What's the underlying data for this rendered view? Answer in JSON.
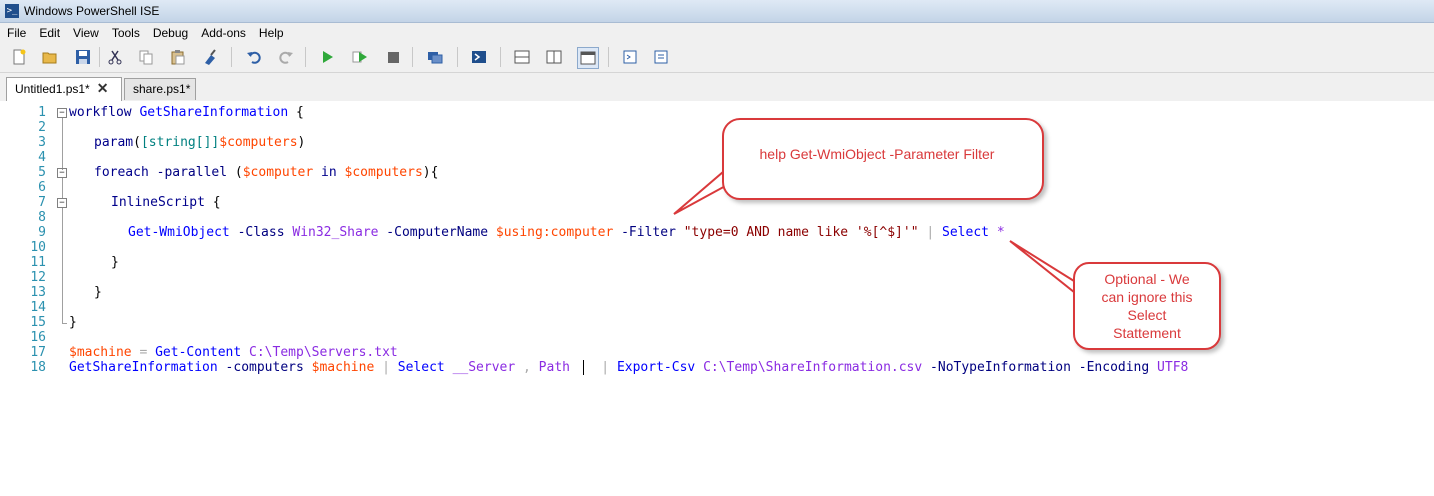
{
  "window": {
    "title": "Windows PowerShell ISE"
  },
  "menu": [
    "File",
    "Edit",
    "View",
    "Tools",
    "Debug",
    "Add-ons",
    "Help"
  ],
  "toolbar": {
    "icons": [
      "new-file",
      "open-folder",
      "save",
      "cut",
      "copy",
      "paste",
      "clear-console",
      "undo",
      "redo",
      "run",
      "run-selection",
      "stop",
      "new-remote-tab",
      "start-powershell",
      "show-script-pane-top",
      "show-script-pane-right",
      "show-script-pane-maximized",
      "show-command-window",
      "show-command-addon"
    ]
  },
  "tabs": [
    {
      "label": "Untitled1.ps1*",
      "active": true,
      "close": "✕"
    },
    {
      "label": "share.ps1*",
      "active": false
    }
  ],
  "editor": {
    "line_numbers": [
      "1",
      "2",
      "3",
      "4",
      "5",
      "6",
      "7",
      "8",
      "9",
      "10",
      "11",
      "12",
      "13",
      "14",
      "15",
      "16",
      "17",
      "18"
    ],
    "code": {
      "l1_kw": "workflow",
      "l1_name": "GetShareInformation",
      "l1_brace": "{",
      "l3_kw": "param",
      "l3_open": "(",
      "l3_type": "[string[]]",
      "l3_var": "$computers",
      "l3_close": ")",
      "l5_kw": "foreach",
      "l5_param": "-parallel",
      "l5_open": "(",
      "l5_var1": "$computer",
      "l5_in": "in",
      "l5_var2": "$computers",
      "l5_close": "){",
      "l7_kw": "InlineScript",
      "l7_brace": "{",
      "l9_cmd": "Get-WmiObject",
      "l9_p1": "-Class",
      "l9_a1": "Win32_Share",
      "l9_p2": "-ComputerName",
      "l9_var": "$using:computer",
      "l9_p3": "-Filter",
      "l9_str": "\"type=0 AND name like '%[^$]'\"",
      "l9_pipe": "|",
      "l9_cmd2": "Select",
      "l9_star": "*",
      "l11": "}",
      "l13": "}",
      "l15": "}",
      "l17_var": "$machine",
      "l17_eq": "=",
      "l17_cmd": "Get-Content",
      "l17_arg": "C:\\Temp\\Servers.txt",
      "l18_cmd": "GetShareInformation",
      "l18_p1": "-computers",
      "l18_var": "$machine",
      "l18_pipe": "|",
      "l18_cmd2": "Select",
      "l18_a1": "__Server",
      "l18_comma": ",",
      "l18_a2": "Path",
      "l18_pipe2": "|",
      "l18_cmd3": "Export-Csv",
      "l18_a3": "C:\\Temp\\ShareInformation.csv",
      "l18_p2": "-NoTypeInformation",
      "l18_p3": "-Encoding",
      "l18_a4": "UTF8"
    }
  },
  "annotations": [
    {
      "text": "help Get-WmiObject -Parameter Filter"
    },
    {
      "text": "Optional - We can ignore this Select Stattement"
    }
  ],
  "colors": {
    "callout_border": "#d9393b",
    "line_number": "#2b91af"
  }
}
